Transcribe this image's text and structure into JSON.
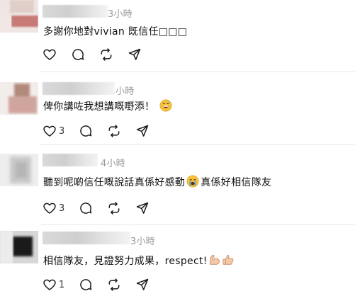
{
  "comments": [
    {
      "time": "3小時",
      "text": "多謝你地對vivian 既信任□□□",
      "likes": "",
      "emoji": []
    },
    {
      "time": "小時",
      "text": "俾你講咗我想講嘅嘢添！",
      "likes": "3",
      "emoji": [
        "grinning-sweat-emoji"
      ]
    },
    {
      "time": "4小時",
      "text_before": "聽到呢啲信任嘅說話真係好感動",
      "text_after": "真係好相信隊友",
      "likes": "3",
      "emoji": [
        "crying-emoji"
      ]
    },
    {
      "time": "3小時",
      "text": "相信隊友，見證努力成果，respect!",
      "likes": "1",
      "emoji": [
        "flexed-biceps-emoji",
        "thumbs-up-emoji"
      ]
    }
  ],
  "icons": {
    "like": "heart-icon",
    "reply": "comment-icon",
    "repost": "repost-icon",
    "share": "share-icon"
  }
}
